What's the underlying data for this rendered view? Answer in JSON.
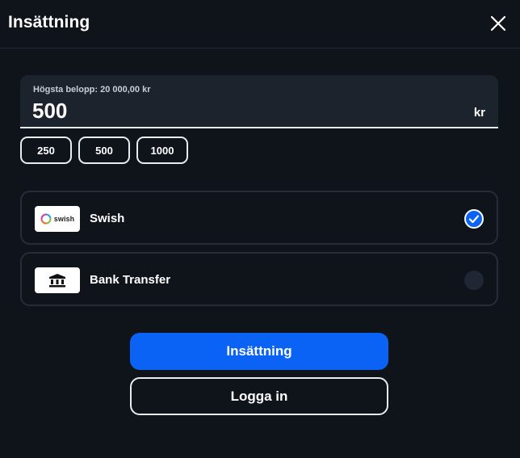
{
  "header": {
    "title": "Insättning",
    "close_icon": "close-icon"
  },
  "amount": {
    "hint": "Högsta belopp: 20 000,00 kr",
    "value": "500",
    "unit": "kr"
  },
  "quick_amounts": [
    "250",
    "500",
    "1000"
  ],
  "payment_methods": [
    {
      "label": "Swish",
      "logo_text": "swish",
      "icon": "swish-logo",
      "selected": true
    },
    {
      "label": "Bank Transfer",
      "icon": "bank-icon",
      "selected": false
    }
  ],
  "actions": {
    "deposit_label": "Insättning",
    "login_label": "Logga in"
  },
  "colors": {
    "background": "#0f141b",
    "accent": "#0a63f5",
    "input_background": "#1d232c"
  }
}
